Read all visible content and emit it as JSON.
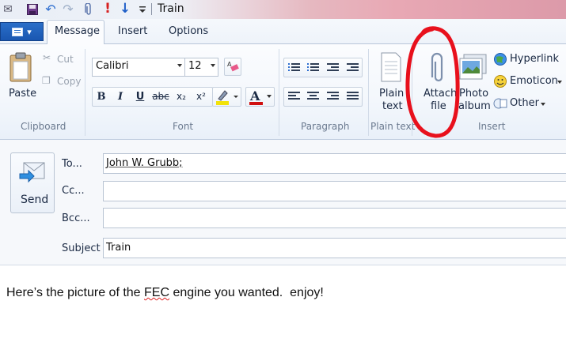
{
  "window": {
    "title": "Train"
  },
  "tabs": [
    {
      "label": "Message",
      "active": true
    },
    {
      "label": "Insert",
      "active": false
    },
    {
      "label": "Options",
      "active": false
    }
  ],
  "ribbon": {
    "clipboard": {
      "group_label": "Clipboard",
      "paste": "Paste",
      "cut": "Cut",
      "copy": "Copy"
    },
    "font": {
      "group_label": "Font",
      "family": "Calibri",
      "size": "12",
      "bold": "B",
      "italic": "I",
      "underline": "U",
      "strike": "abc",
      "subscript": "x₂",
      "superscript": "x²",
      "font_color_letter": "A"
    },
    "paragraph": {
      "group_label": "Paragraph"
    },
    "plain_text": {
      "group_label": "Plain text",
      "button": [
        "Plain",
        "text"
      ]
    },
    "insert": {
      "group_label": "Insert",
      "attach": [
        "Attach",
        "file"
      ],
      "photo": [
        "Photo",
        "album"
      ],
      "hyperlink": "Hyperlink",
      "emoticon": "Emoticon",
      "other": "Other"
    }
  },
  "compose": {
    "send_label": "Send",
    "to_label": "To...",
    "cc_label": "Cc...",
    "bcc_label": "Bcc...",
    "subject_label": "Subject",
    "to_value": "John W. Grubb;",
    "cc_value": "",
    "bcc_value": "",
    "subject_value": "Train"
  },
  "message_body": {
    "before": "Here’s the picture of the ",
    "misspelled": "FEC",
    "after": " engine you wanted.  enjoy!"
  },
  "colors": {
    "annotation_circle": "#e8101c",
    "app_button": "#1a56b0",
    "highlight": "#f2e20a",
    "font_color": "#d01010"
  }
}
